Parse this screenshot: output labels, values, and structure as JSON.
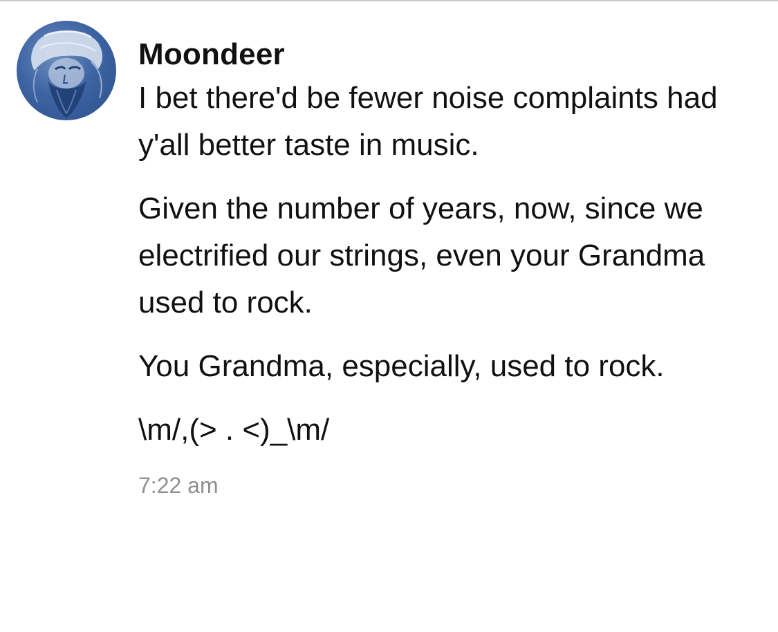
{
  "message": {
    "sender_name": "Moondeer",
    "avatar_icon": "bearded-face-avatar",
    "paragraphs": [
      "I bet there'd be fewer noise complaints had y'all better taste in music.",
      "Given the number of years, now, since we electrified our strings, even your Grandma used to rock.",
      "You Grandma, especially, used to rock.",
      "\\m/,(> . <)_\\m/"
    ],
    "timestamp": "7:22 am"
  },
  "colors": {
    "text": "#111111",
    "timestamp": "#8e8e93",
    "avatar_blue": "#3d64a3",
    "divider": "#c8c8c8"
  }
}
